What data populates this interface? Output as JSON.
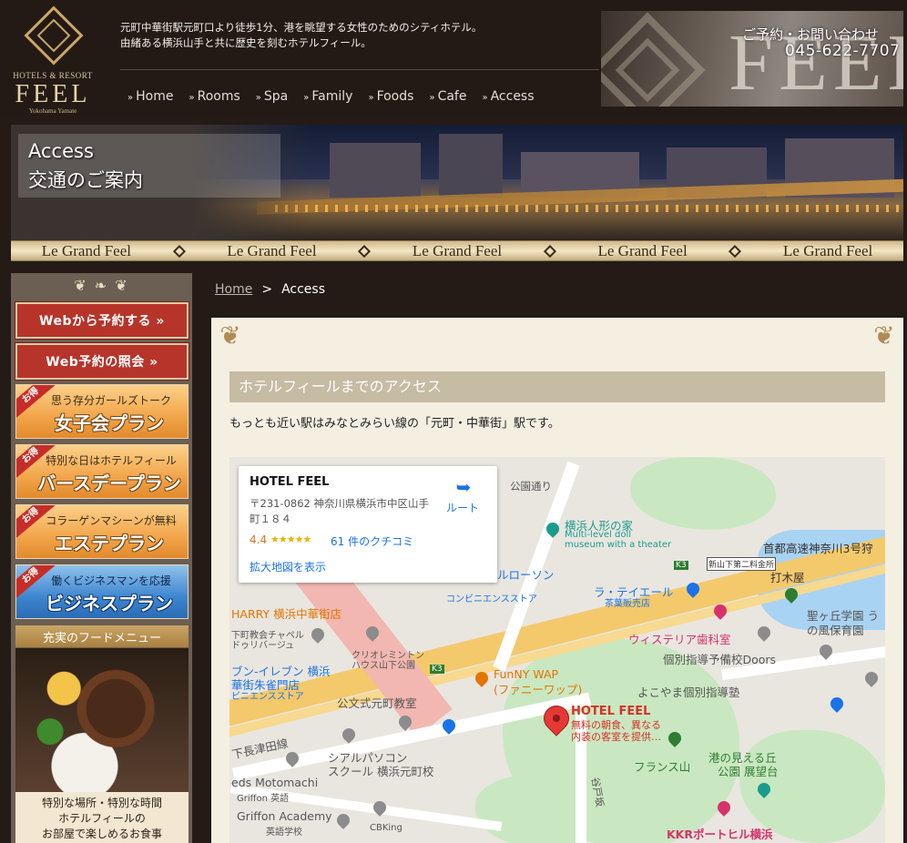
{
  "header": {
    "logo": {
      "tag": "HOTELS & RESORT",
      "name": "FEEL",
      "sub": "Yokohama Yamate"
    },
    "tagline_1": "元町中華街駅元町口より徒歩1分、港を眺望する女性のためのシティホテル。",
    "tagline_2": "由緒ある横浜山手と共に歴史を刻むホテルフィール。",
    "contact_label": "ご予約・お問い合わせ",
    "contact_phone": "045-622-7707",
    "nav": [
      "Home",
      "Rooms",
      "Spa",
      "Family",
      "Foods",
      "Cafe",
      "Access"
    ],
    "nav_arrow": "»"
  },
  "hero": {
    "title_en": "Access",
    "title_jp": "交通のご案内",
    "ribbon": [
      "Le Grand Feel",
      "Le Grand Feel",
      "Le Grand Feel",
      "Le Grand Feel",
      "Le Grand Feel"
    ]
  },
  "sidebar": {
    "buttons": [
      {
        "label": "Webから予約する »"
      },
      {
        "label": "Web予約の照会 »"
      }
    ],
    "plans": [
      {
        "badge": "お得",
        "line1": "思う存分ガールズトーク",
        "line2": "女子会プラン",
        "style": "orange"
      },
      {
        "badge": "お得",
        "line1": "特別な日はホテルフィール",
        "line2": "バースデープラン",
        "style": "orange"
      },
      {
        "badge": "お得",
        "line1": "コラーゲンマシーンが無料",
        "line2": "エステプラン",
        "style": "orange"
      },
      {
        "badge": "お得",
        "line1": "働くビジネスマンを応援",
        "line2": "ビジネスプラン",
        "style": "blue"
      }
    ],
    "food_head": "充実のフードメニュー",
    "food_text_1": "特別な場所・特別な時間",
    "food_text_2": "ホテルフィールの",
    "food_text_3": "お部屋で楽しめるお食事"
  },
  "breadcrumb": {
    "home": "Home",
    "separator": ">",
    "current": "Access"
  },
  "main": {
    "section_title": "ホテルフィールまでのアクセス",
    "intro": "もっとも近い駅はみなとみらい線の「元町・中華街」駅です。"
  },
  "map": {
    "infowindow": {
      "name": "HOTEL FEEL",
      "address": "〒231-0862 神奈川県横浜市中区山手町１８４",
      "rating": "4.4",
      "stars": "★★★★★",
      "reviews": "61 件のクチコミ",
      "link": "拡大地図を表示",
      "route": "ルート"
    },
    "hotel_label": "HOTEL FEEL",
    "hotel_desc_1": "無料の朝食、異なる",
    "hotel_desc_2": "内装の客室を提供…",
    "labels": [
      "公園通り",
      "横浜人形の家",
      "Multi-level doll",
      "museum with a theater",
      "首都高速神奈川3号狩",
      "新山下第二料金所",
      "打木屋",
      "ルローソン",
      "コンビニエンスストア",
      "ラ・テイエール",
      "茶葉販売店",
      "聖ヶ丘学園 う",
      "の風保育園",
      "HARRY 横浜中華街店",
      "ウィステリア歯科室",
      "個別指導予備校Doors",
      "下町教会チャペル",
      "ドゥリバージュ",
      "クリオレミントン",
      "ハウス山下公園",
      "ブン-イレブン 横浜",
      "華街朱雀門店",
      "ビニエンスストア",
      "FunNY WAP",
      "(ファニーワップ)",
      "よこやま個別指導塾",
      "公文式元町教室",
      "下長津田線",
      "シアルパソコン",
      "スクール 横浜元町校",
      "フランス山",
      "港の見える丘",
      "公園 展望台",
      "eds Motomachi",
      "Griffon 英語",
      "Griffon Academy",
      "英語学校",
      "CBKing",
      "谷戸坂",
      "KKRポートヒル横浜",
      "K3",
      "K3"
    ]
  }
}
